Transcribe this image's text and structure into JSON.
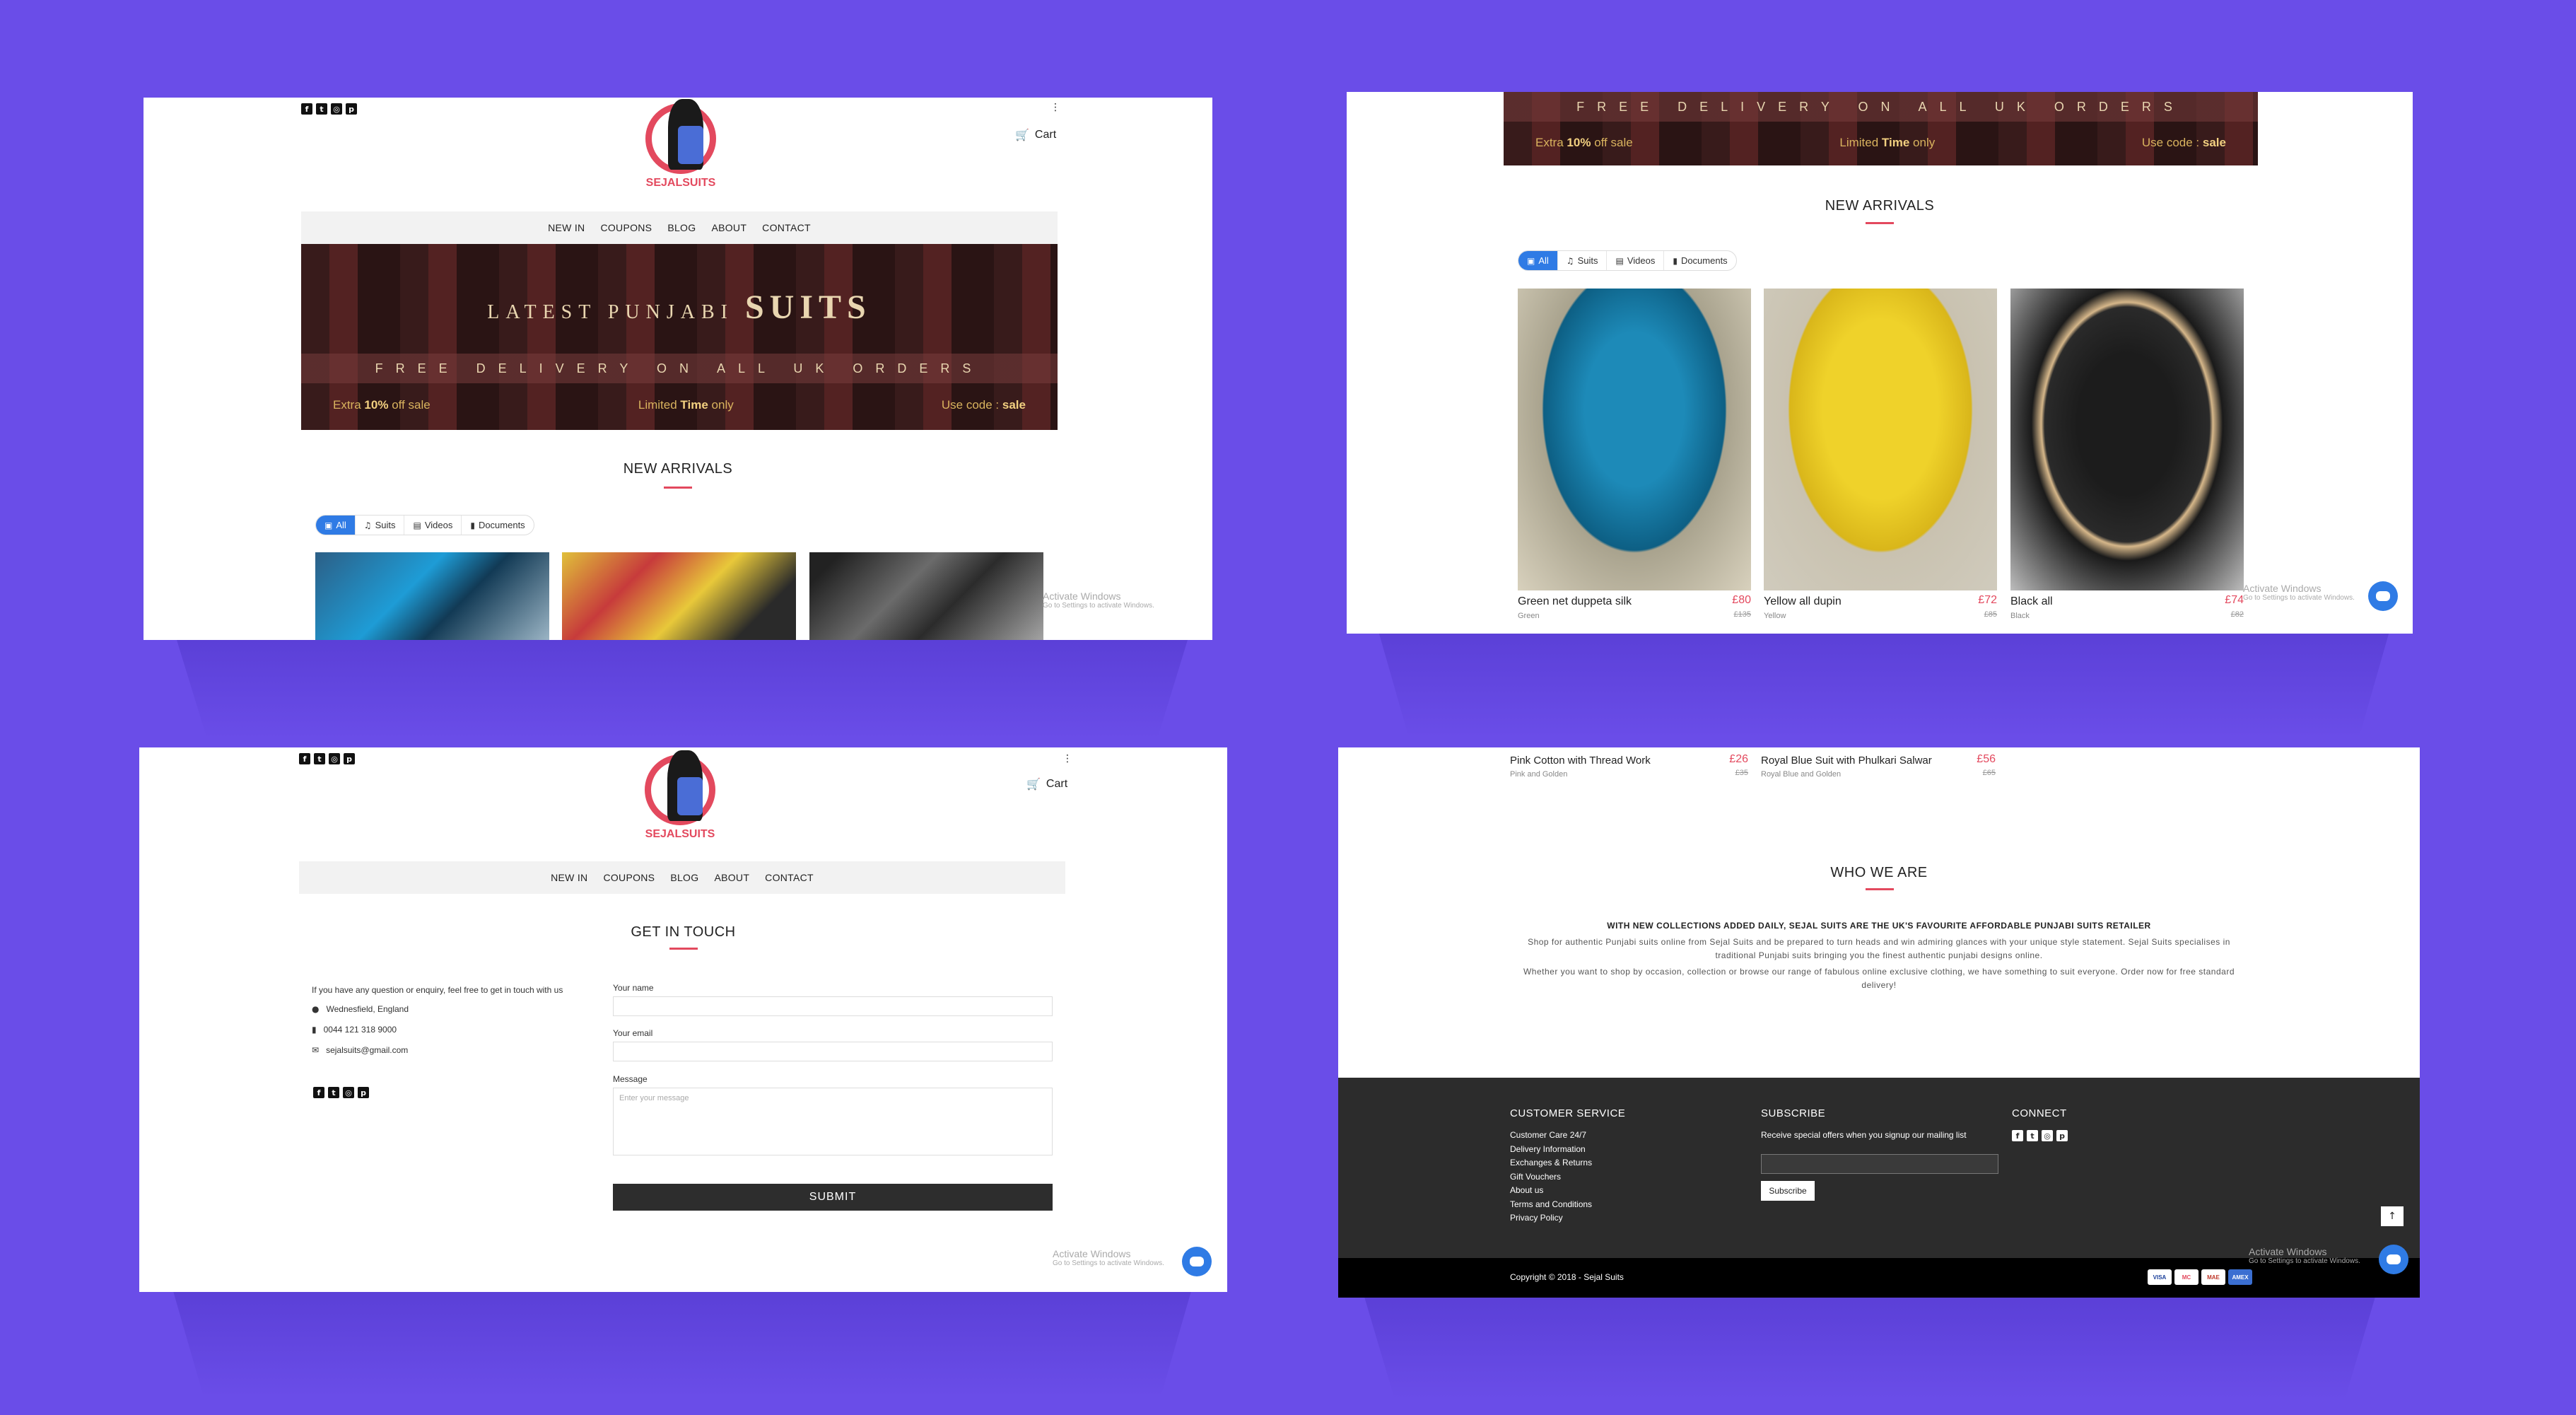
{
  "social_icons": [
    "facebook-icon",
    "twitter-icon",
    "instagram-icon",
    "pinterest-icon"
  ],
  "logo": {
    "part1": "SEJAL",
    "part2": "SUITS"
  },
  "header": {
    "cart_label": "Cart",
    "menu_dot": "⋮"
  },
  "nav": [
    "NEW IN",
    "COUPONS",
    "BLOG",
    "ABOUT",
    "CONTACT"
  ],
  "banner": {
    "title_prefix": "LATEST PUNJABI",
    "title_main": "SUITS",
    "delivery": "FREE DELIVERY ON ALL UK ORDERS",
    "extra_prefix": "Extra",
    "extra_bold": "10%",
    "extra_suffix": "off sale",
    "limited_prefix": "Limited",
    "limited_bold": "Time",
    "limited_suffix": "only",
    "code_prefix": "Use code :",
    "code_bold": "sale"
  },
  "new_arrivals": "NEW ARRIVALS",
  "tabs": [
    {
      "label": "All",
      "icon": "image-icon"
    },
    {
      "label": "Suits",
      "icon": "music-icon"
    },
    {
      "label": "Videos",
      "icon": "film-icon"
    },
    {
      "label": "Documents",
      "icon": "file-icon"
    }
  ],
  "products": [
    {
      "name": "Green net duppeta silk",
      "variant": "Green",
      "price": "£80",
      "old_price": "£135"
    },
    {
      "name": "Yellow all dupin",
      "variant": "Yellow",
      "price": "£72",
      "old_price": "£85"
    },
    {
      "name": "Black all",
      "variant": "Black",
      "price": "£74",
      "old_price": "£82"
    }
  ],
  "products_more": [
    {
      "name": "Pink Cotton with Thread Work",
      "variant": "Pink and Golden",
      "price": "£26",
      "old_price": "£35"
    },
    {
      "name": "Royal Blue Suit with Phulkari Salwar",
      "variant": "Royal Blue and Golden",
      "price": "£56",
      "old_price": "£65"
    }
  ],
  "windows": {
    "title": "Activate Windows",
    "sub": "Go to Settings to activate Windows."
  },
  "contact": {
    "heading": "GET IN TOUCH",
    "intro": "If you have any question or enquiry, feel free to get in touch with us",
    "address": "Wednesfield, England",
    "phone": "0044 121 318 9000",
    "email": "sejalsuits@gmail.com",
    "name_label": "Your name",
    "email_label": "Your email",
    "message_label": "Message",
    "message_placeholder": "Enter your message",
    "submit": "SUBMIT"
  },
  "about": {
    "heading": "WHO WE ARE",
    "tagline": "WITH NEW COLLECTIONS ADDED DAILY, SEJAL SUITS ARE THE UK'S FAVOURITE AFFORDABLE PUNJABI SUITS RETAILER",
    "p1": "Shop for authentic Punjabi suits online from Sejal Suits and be prepared to turn heads and win admiring glances with your unique style statement. Sejal Suits specialises in traditional Punjabi suits bringing you the finest authentic punjabi designs online.",
    "p2": "Whether you want to shop by occasion, collection or browse our range of fabulous online exclusive clothing, we have something to suit everyone. Order now for free standard delivery!"
  },
  "footer": {
    "customer_service": "CUSTOMER SERVICE",
    "links": [
      "Customer Care 24/7",
      "Delivery Information",
      "Exchanges & Returns",
      "Gift Vouchers",
      "About us",
      "Terms and Conditions",
      "Privacy Policy"
    ],
    "subscribe": "SUBSCRIBE",
    "subscribe_text": "Receive special offers when you signup our mailing list",
    "subscribe_button": "Subscribe",
    "connect": "CONNECT",
    "copyright": "Copyright © 2018 - Sejal Suits",
    "payment_cards": [
      "VISA",
      "MC",
      "MAE",
      "AMEX"
    ]
  },
  "colors": {
    "background": "#6a4de8",
    "accent": "#e3495e",
    "tab_active": "#2f7be5",
    "footer": "#2c2c2c"
  }
}
